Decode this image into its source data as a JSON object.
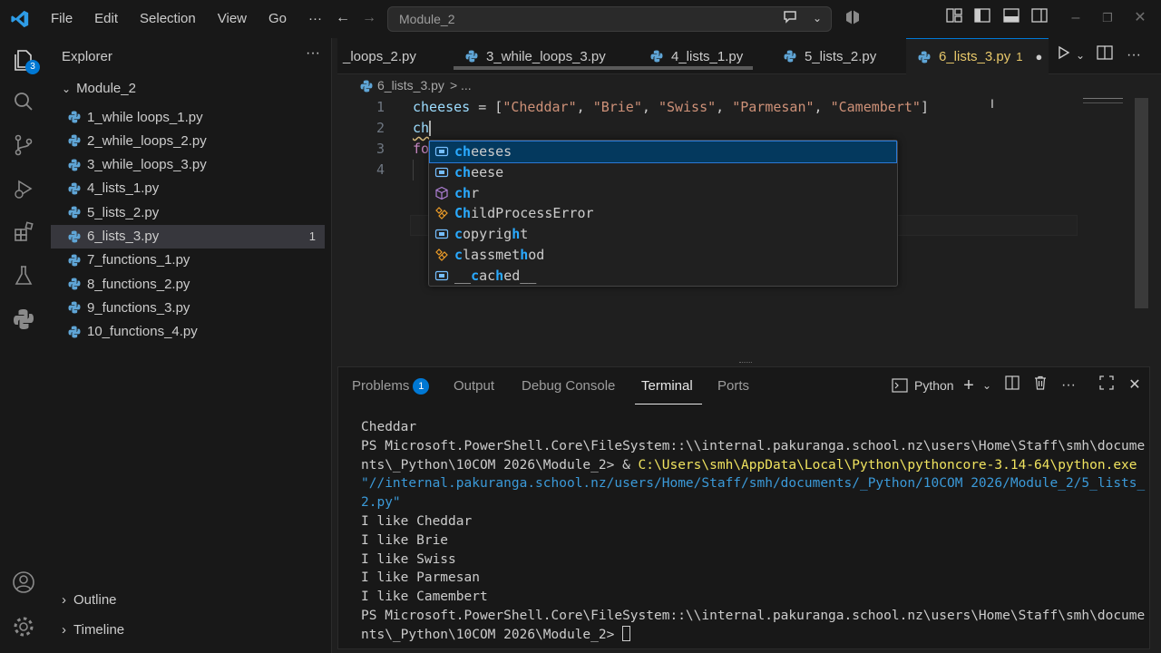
{
  "titlebar": {
    "menu": [
      "File",
      "Edit",
      "Selection",
      "View",
      "Go"
    ],
    "more": "···",
    "search_text": "Module_2"
  },
  "activity": {
    "explorer_badge": "3"
  },
  "sidebar": {
    "title": "Explorer",
    "more": "···",
    "folder": "Module_2",
    "files": [
      {
        "name": "1_while loops_1.py",
        "badge": ""
      },
      {
        "name": "2_while_loops_2.py",
        "badge": ""
      },
      {
        "name": "3_while_loops_3.py",
        "badge": ""
      },
      {
        "name": "4_lists_1.py",
        "badge": ""
      },
      {
        "name": "5_lists_2.py",
        "badge": ""
      },
      {
        "name": "6_lists_3.py",
        "badge": "1"
      },
      {
        "name": "7_functions_1.py",
        "badge": ""
      },
      {
        "name": "8_functions_2.py",
        "badge": ""
      },
      {
        "name": "9_functions_3.py",
        "badge": ""
      },
      {
        "name": "10_functions_4.py",
        "badge": ""
      }
    ],
    "outline": "Outline",
    "timeline": "Timeline"
  },
  "tabs": [
    {
      "label": "_loops_2.py"
    },
    {
      "label": "3_while_loops_3.py"
    },
    {
      "label": "4_lists_1.py"
    },
    {
      "label": "5_lists_2.py"
    },
    {
      "label": "6_lists_3.py",
      "count": "1"
    }
  ],
  "breadcrumb": {
    "file": "6_lists_3.py",
    "rest": "> ..."
  },
  "editor": {
    "line_numbers": [
      "1",
      "2",
      "3",
      "4"
    ],
    "line1": {
      "var": "cheeses",
      "op": " = [",
      "items": [
        "\"Cheddar\"",
        "\"Brie\"",
        "\"Swiss\"",
        "\"Parmesan\"",
        "\"Camembert\""
      ],
      "sep": ", ",
      "end": "]"
    },
    "line2": "ch",
    "line3": "fo"
  },
  "suggestions": [
    {
      "hl": "ch",
      "rest": "eeses",
      "kind": "variable"
    },
    {
      "hl": "ch",
      "rest": "eese",
      "kind": "variable"
    },
    {
      "hl": "ch",
      "rest": "r",
      "kind": "function"
    },
    {
      "hl": "Ch",
      "rest": "ildProcessError",
      "kind": "class"
    },
    {
      "pre": "c",
      "mid": "opyrig",
      "hl2": "h",
      "rest": "t",
      "kind": "variable"
    },
    {
      "pre": "c",
      "mid": "lassmet",
      "hl2": "h",
      "rest": "od",
      "kind": "class"
    },
    {
      "pre": "__",
      "hl": "c",
      "mid": "ac",
      "hl2": "h",
      "rest": "ed__",
      "kind": "variable"
    }
  ],
  "panel": {
    "tabs": [
      "Problems",
      "Output",
      "Debug Console",
      "Terminal",
      "Ports"
    ],
    "problems_count": "1",
    "terminal_name": "Python",
    "terminal": {
      "l1": "Cheddar",
      "l2": "PS Microsoft.PowerShell.Core\\FileSystem::\\\\internal.pakuranga.school.nz\\users\\Home\\Staff\\smh\\docume",
      "l3a": "nts\\_Python\\10COM 2026\\Module_2> & ",
      "l3b": "C:\\Users\\smh\\AppData\\Local\\Python\\pythoncore-3.14-64\\python.exe",
      "l4": "\"//internal.pakuranga.school.nz/users/Home/Staff/smh/documents/_Python/10COM 2026/Module_2/5_lists_",
      "l5": "2.py\"",
      "l6": "I like Cheddar",
      "l7": "I like Brie",
      "l8": "I like Swiss",
      "l9": "I like Parmesan",
      "l10": "I like Camembert",
      "l11": "PS Microsoft.PowerShell.Core\\FileSystem::\\\\internal.pakuranga.school.nz\\users\\Home\\Staff\\smh\\docume",
      "l12": "nts\\_Python\\10COM 2026\\Module_2> "
    }
  },
  "colors": {
    "accent": "#0078d4",
    "modified_tab": "#e8c86a",
    "badge": "#0078d4"
  }
}
